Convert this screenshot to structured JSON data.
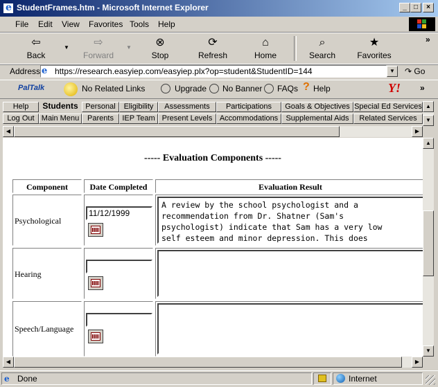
{
  "window": {
    "title": "StudentFrames.htm - Microsoft Internet Explorer"
  },
  "menu": [
    "File",
    "Edit",
    "View",
    "Favorites",
    "Tools",
    "Help"
  ],
  "toolbar": {
    "back": "Back",
    "forward": "Forward",
    "stop": "Stop",
    "refresh": "Refresh",
    "home": "Home",
    "search": "Search",
    "favorites": "Favorites",
    "more": "»"
  },
  "address": {
    "label": "Address",
    "url": "https://research.easyiep.com/easyiep.plx?op=student&StudentID=144",
    "go": "Go"
  },
  "links": {
    "paltalk": "PalTalk",
    "related": "No Related Links",
    "upgrade": "Upgrade",
    "nobanner": "No Banner",
    "faqs": "FAQs",
    "help": "Help",
    "more": "»"
  },
  "nav": {
    "row1": [
      "Help",
      "Students",
      "Personal",
      "Eligibility",
      "Assessments",
      "Participations",
      "Goals & Objectives",
      "Special Ed Services"
    ],
    "row2": [
      "Log Out",
      "Main Menu",
      "Parents",
      "IEP Team",
      "Present Levels",
      "Accommodations",
      "Supplemental Aids",
      "Related Services"
    ]
  },
  "page": {
    "heading": "----- Evaluation Components -----",
    "columns": [
      "Component",
      "Date Completed",
      "Evaluation Result"
    ],
    "rows": [
      {
        "component": "Psychological",
        "date": "11/12/1999",
        "result": "A review by the school psychologist and a\nrecommendation from Dr. Shatner (Sam's\npsychologist) indicate that Sam has a very low\nself esteem and minor depression. This does"
      },
      {
        "component": "Hearing",
        "date": "",
        "result": ""
      },
      {
        "component": "Speech/Language",
        "date": "",
        "result": ""
      }
    ]
  },
  "status": {
    "text": "Done",
    "zone": "Internet"
  }
}
